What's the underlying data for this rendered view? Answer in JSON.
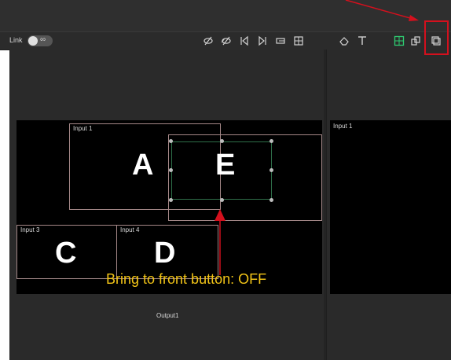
{
  "toolbar": {
    "link_label": "Link",
    "link_icon": "chain-link-icon",
    "left_buttons": [
      "hide-icon",
      "hide-all-icon",
      "prev-icon",
      "next-icon",
      "fit-icon",
      "grid-icon"
    ],
    "right_buttons": [
      "erase-icon",
      "text-icon",
      "select-green-icon",
      "layers-icon",
      "bring-to-front-icon"
    ]
  },
  "preview": {
    "windows": [
      {
        "label": "Input 1",
        "letter": "A"
      },
      {
        "label": "Input 3",
        "letter": "C"
      },
      {
        "label": "Input 4",
        "letter": "D"
      }
    ],
    "selected_letter": "E",
    "output_label": "Output1"
  },
  "right_preview": {
    "label": "Input 1"
  },
  "annotation": {
    "text": "Bring to front button: OFF",
    "text_color": "#f2c417",
    "arrow_color": "#d4101d"
  },
  "colors": {
    "panel_bg": "#2a2a2a",
    "canvas_bg": "#000000",
    "window_border": "#a48888",
    "selection_border": "#2f6f4a",
    "highlight": "#d4101d"
  }
}
